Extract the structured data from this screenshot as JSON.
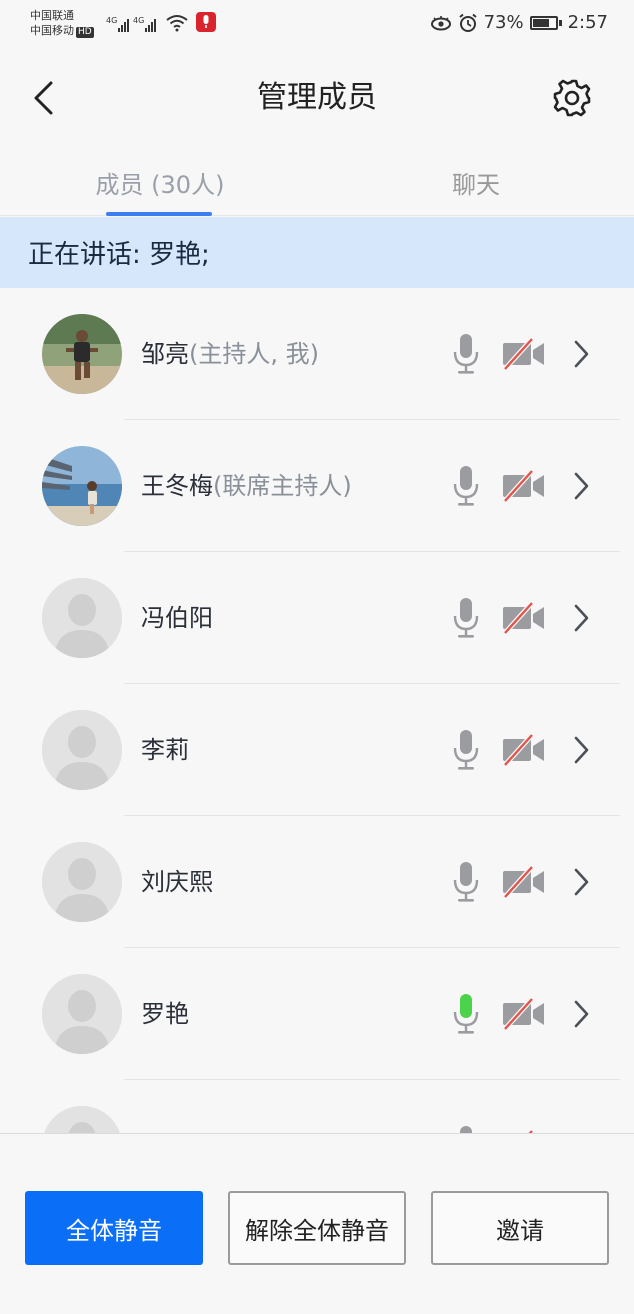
{
  "status_bar": {
    "carrier1": "中国联通",
    "carrier2": "中国移动",
    "hd": "HD",
    "network1": "4G",
    "network2": "4G",
    "battery": "73%",
    "battery_level": 0.73,
    "time": "2:57"
  },
  "header": {
    "title": "管理成员"
  },
  "tabs": {
    "members": "成员 (30人)",
    "chat": "聊天"
  },
  "speaking": {
    "text": "正在讲话: 罗艳;"
  },
  "members": [
    {
      "name": "邹亮",
      "role": "(主持人, 我)",
      "avatar": "photo-runner",
      "mic": "muted",
      "video": "off"
    },
    {
      "name": "王冬梅",
      "role": "(联席主持人)",
      "avatar": "photo-beach",
      "mic": "muted",
      "video": "off"
    },
    {
      "name": "冯伯阳",
      "role": "",
      "avatar": "default-person",
      "mic": "muted",
      "video": "off"
    },
    {
      "name": "李莉",
      "role": "",
      "avatar": "default-person",
      "mic": "muted",
      "video": "off"
    },
    {
      "name": "刘庆熙",
      "role": "",
      "avatar": "default-person",
      "mic": "muted",
      "video": "off"
    },
    {
      "name": "罗艳",
      "role": "",
      "avatar": "default-person",
      "mic": "speaking",
      "video": "off"
    }
  ],
  "buttons": {
    "mute_all": "全体静音",
    "unmute_all": "解除全体静音",
    "invite": "邀请"
  },
  "colors": {
    "accent": "#0a6ef7",
    "banner": "#d6e6fb",
    "speaking_mic": "#4cd34c",
    "video_off_slash": "#e0554c"
  }
}
